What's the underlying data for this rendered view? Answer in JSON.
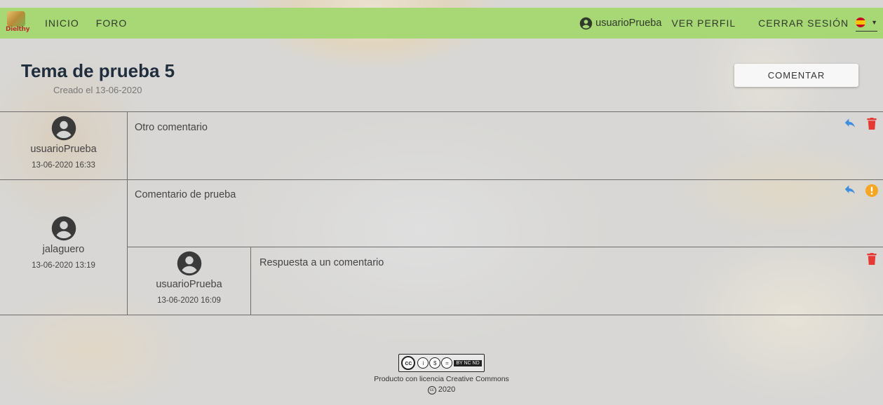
{
  "nav": {
    "logo_text": "Dielthy",
    "links": [
      "INICIO",
      "FORO"
    ],
    "username": "usuarioPrueba",
    "profile": "VER PERFIL",
    "logout": "CERRAR SESIÓN",
    "language_icon": "spain-flag-icon"
  },
  "topic": {
    "title": "Tema de prueba 5",
    "created": "Creado el 13-06-2020",
    "comment_button": "COMENTAR"
  },
  "comments": [
    {
      "author": "usuarioPrueba",
      "time": "13-06-2020 16:33",
      "text": "Otro comentario",
      "actions": [
        "reply-icon",
        "delete-icon"
      ]
    },
    {
      "author": "jalaguero",
      "time": "13-06-2020 13:19",
      "text": "Comentario de prueba",
      "actions": [
        "reply-icon",
        "report-icon"
      ],
      "replies": [
        {
          "author": "usuarioPrueba",
          "time": "13-06-2020 16:09",
          "text": "Respuesta a un comentario",
          "actions": [
            "delete-icon"
          ]
        }
      ]
    }
  ],
  "footer": {
    "license_badge": "BY NC ND",
    "license_text": "Producto con licencia Creative Commons",
    "copyright": "2020"
  },
  "colors": {
    "navbar": "#a8d776",
    "reply": "#3f8ee0",
    "delete": "#e53935",
    "report": "#f5a623"
  }
}
